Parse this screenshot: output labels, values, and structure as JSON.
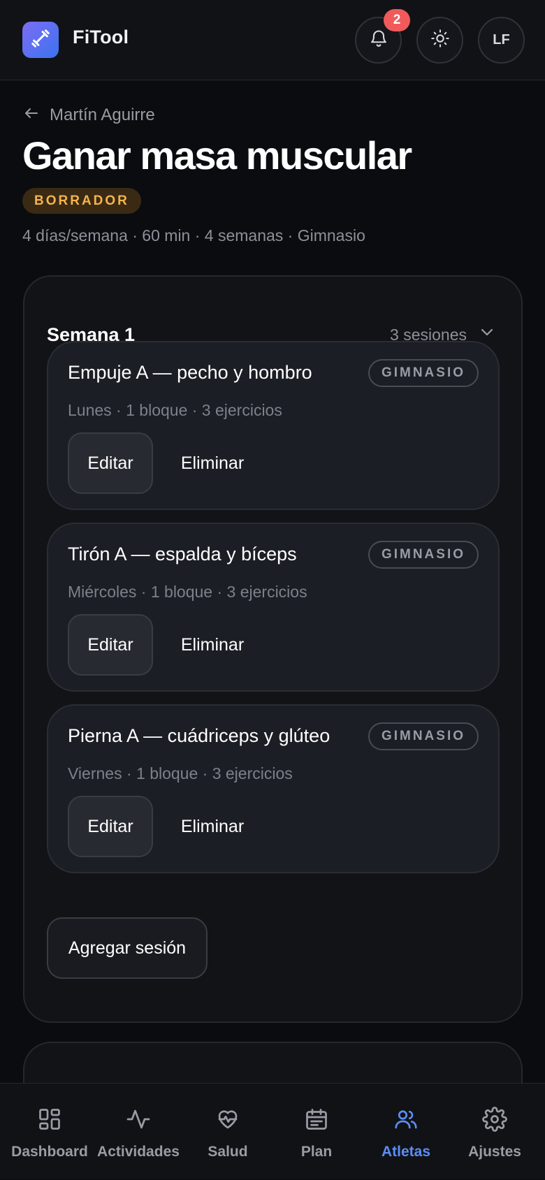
{
  "header": {
    "brand": "FiTool",
    "notification_count": "2",
    "avatar_initials": "LF"
  },
  "breadcrumb": {
    "back_label": "Martín Aguirre"
  },
  "plan": {
    "title": "Ganar masa muscular",
    "status": "BORRADOR",
    "meta": "4 días/semana · 60 min · 4 semanas · Gimnasio"
  },
  "week": {
    "title": "Semana 1",
    "count": "3 sesiones",
    "sessions": [
      {
        "title": "Empuje A — pecho y hombro",
        "tag": "GIMNASIO",
        "meta": "Lunes · 1 bloque · 3 ejercicios",
        "edit_label": "Editar",
        "delete_label": "Eliminar"
      },
      {
        "title": "Tirón A — espalda y bíceps",
        "tag": "GIMNASIO",
        "meta": "Miércoles · 1 bloque · 3 ejercicios",
        "edit_label": "Editar",
        "delete_label": "Eliminar"
      },
      {
        "title": "Pierna A — cuádriceps y glúteo",
        "tag": "GIMNASIO",
        "meta": "Viernes · 1 bloque · 3 ejercicios",
        "edit_label": "Editar",
        "delete_label": "Eliminar"
      }
    ],
    "add_session_label": "Agregar sesión"
  },
  "nav": {
    "items": [
      {
        "label": "Dashboard",
        "icon": "dashboard-icon"
      },
      {
        "label": "Actividades",
        "icon": "activity-icon"
      },
      {
        "label": "Salud",
        "icon": "heart-pulse-icon"
      },
      {
        "label": "Plan",
        "icon": "calendar-icon"
      },
      {
        "label": "Atletas",
        "icon": "users-icon",
        "active": true
      },
      {
        "label": "Ajustes",
        "icon": "gear-icon"
      }
    ]
  },
  "colors": {
    "accent": "#5b8ef5",
    "draft_badge_text": "#f5b44d",
    "notification_badge": "#f05a5a",
    "background": "#0b0c0f"
  }
}
